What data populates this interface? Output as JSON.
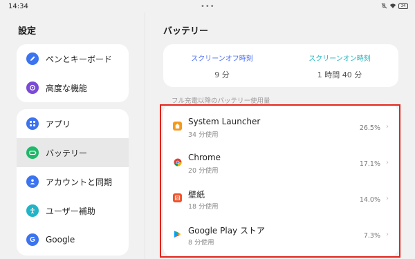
{
  "status": {
    "time": "14:34",
    "dots": "•••",
    "battery": "24"
  },
  "left": {
    "title": "設定",
    "group1": [
      {
        "label": "ペンとキーボード",
        "icon": "pen-icon",
        "color": "#3b73f0"
      },
      {
        "label": "高度な機能",
        "icon": "advanced-features-icon",
        "color": "#7b4ad6"
      }
    ],
    "group2": [
      {
        "label": "アプリ",
        "icon": "apps-icon",
        "color": "#3b73f0"
      },
      {
        "label": "バッテリー",
        "icon": "battery-icon",
        "color": "#1fb86a",
        "active": true
      },
      {
        "label": "アカウントと同期",
        "icon": "account-icon",
        "color": "#3b73f0"
      },
      {
        "label": "ユーザー補助",
        "icon": "accessibility-icon",
        "color": "#23b3c6"
      },
      {
        "label": "Google",
        "icon": "google-icon",
        "color": "#3b73f0"
      }
    ]
  },
  "right": {
    "title": "バッテリー",
    "screen_off_label": "スクリーンオフ時刻",
    "screen_off_value": "9 分",
    "screen_on_label": "スクリーンオン時刻",
    "screen_on_value": "1 時間 40 分",
    "section_label": "フル充電以降のバッテリー使用量",
    "apps": [
      {
        "name": "System Launcher",
        "usage": "34 分使用",
        "percent": "26.5%",
        "icon": "system-launcher-icon",
        "color": "#f39a1e"
      },
      {
        "name": "Chrome",
        "usage": "20 分使用",
        "percent": "17.1%",
        "icon": "chrome-icon",
        "color": "#ffffff"
      },
      {
        "name": "壁紙",
        "usage": "18 分使用",
        "percent": "14.0%",
        "icon": "wallpaper-icon",
        "color": "#f0532a"
      },
      {
        "name": "Google Play ストア",
        "usage": "8 分使用",
        "percent": "7.3%",
        "icon": "google-play-icon",
        "color": "#ffffff"
      }
    ],
    "chevron": "›"
  },
  "colors": {
    "highlight": "#e2231a",
    "accent_off": "#4a6cf7",
    "accent_on": "#1fb6c1"
  }
}
